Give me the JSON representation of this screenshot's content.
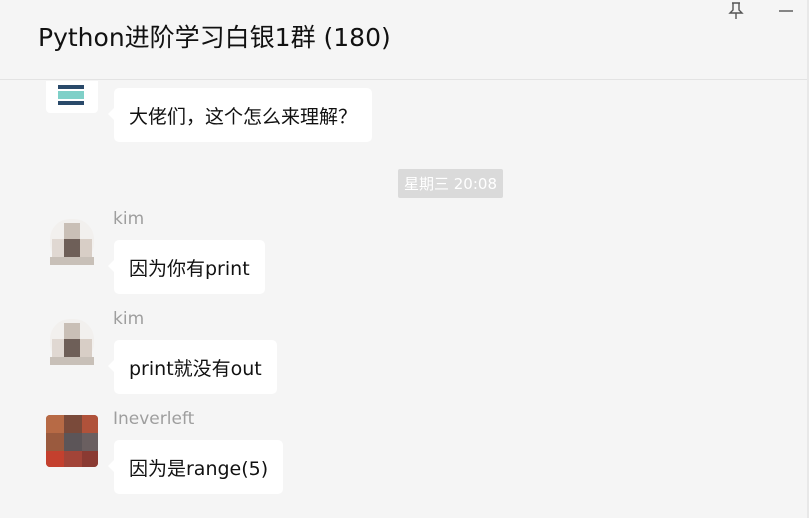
{
  "window": {
    "title": "Python进阶学习白银1群 (180)",
    "pin_icon": "pin-icon",
    "minimize_icon": "minimize-icon"
  },
  "messages": [
    {
      "sender": "",
      "text": "大佬们，这个怎么来理解？",
      "avatar": "group-avatar"
    },
    {
      "sender": "kim",
      "text": "因为你有print",
      "avatar": "kim-avatar"
    },
    {
      "sender": "kim",
      "text": "print就没有out",
      "avatar": "kim-avatar"
    },
    {
      "sender": "Ineverleft",
      "text": "因为是range(5)",
      "avatar": "ineverleft-avatar"
    }
  ],
  "timestamp": "星期三 20:08",
  "colors": {
    "background": "#f5f5f5",
    "bubble": "#ffffff",
    "timestamp_bg": "#dadada",
    "sender_text": "#9e9e9e"
  }
}
